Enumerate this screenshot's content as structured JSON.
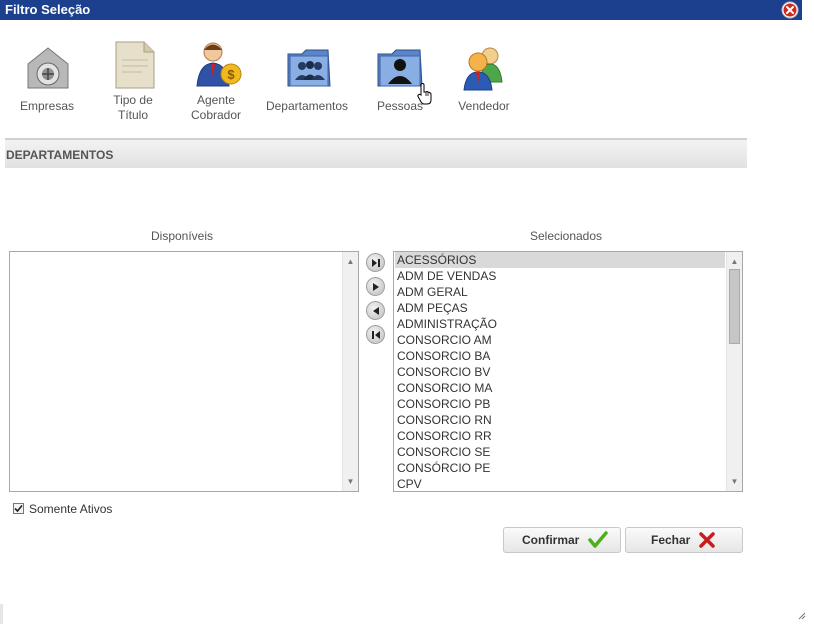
{
  "window": {
    "title": "Filtro Seleção"
  },
  "toolbar": {
    "items": [
      {
        "label": "Empresas",
        "icon": "safe-icon"
      },
      {
        "label_line1": "Tipo de",
        "label_line2": "Título",
        "icon": "document-icon"
      },
      {
        "label_line1": "Agente",
        "label_line2": "Cobrador",
        "icon": "agent-collector-icon"
      },
      {
        "label": "Departamentos",
        "icon": "department-folder-icon"
      },
      {
        "label": "Pessoas",
        "icon": "people-folder-icon"
      },
      {
        "label": "Vendedor",
        "icon": "sellers-icon"
      }
    ]
  },
  "section": {
    "title": "DEPARTAMENTOS"
  },
  "available": {
    "title": "Disponíveis",
    "items": []
  },
  "selected": {
    "title": "Selecionados",
    "items": [
      "ACESSÓRIOS",
      "ADM DE VENDAS",
      "ADM GERAL",
      "ADM PEÇAS",
      "ADMINISTRAÇÃO",
      "CONSORCIO AM",
      "CONSORCIO BA",
      "CONSORCIO BV",
      "CONSORCIO MA",
      "CONSORCIO PB",
      "CONSORCIO RN",
      "CONSORCIO RR",
      "CONSORCIO SE",
      "CONSÓRCIO PE",
      "CPV"
    ],
    "highlighted_index": 0
  },
  "transfer_buttons": [
    "move-all-right",
    "move-right",
    "move-left",
    "move-all-left"
  ],
  "checkbox": {
    "label": "Somente Ativos",
    "checked": true
  },
  "buttons": {
    "confirm": "Confirmar",
    "close": "Fechar"
  },
  "colors": {
    "titlebar": "#1c3f8e",
    "confirm_icon": "#4caf1e",
    "close_icon": "#c81d1d"
  }
}
